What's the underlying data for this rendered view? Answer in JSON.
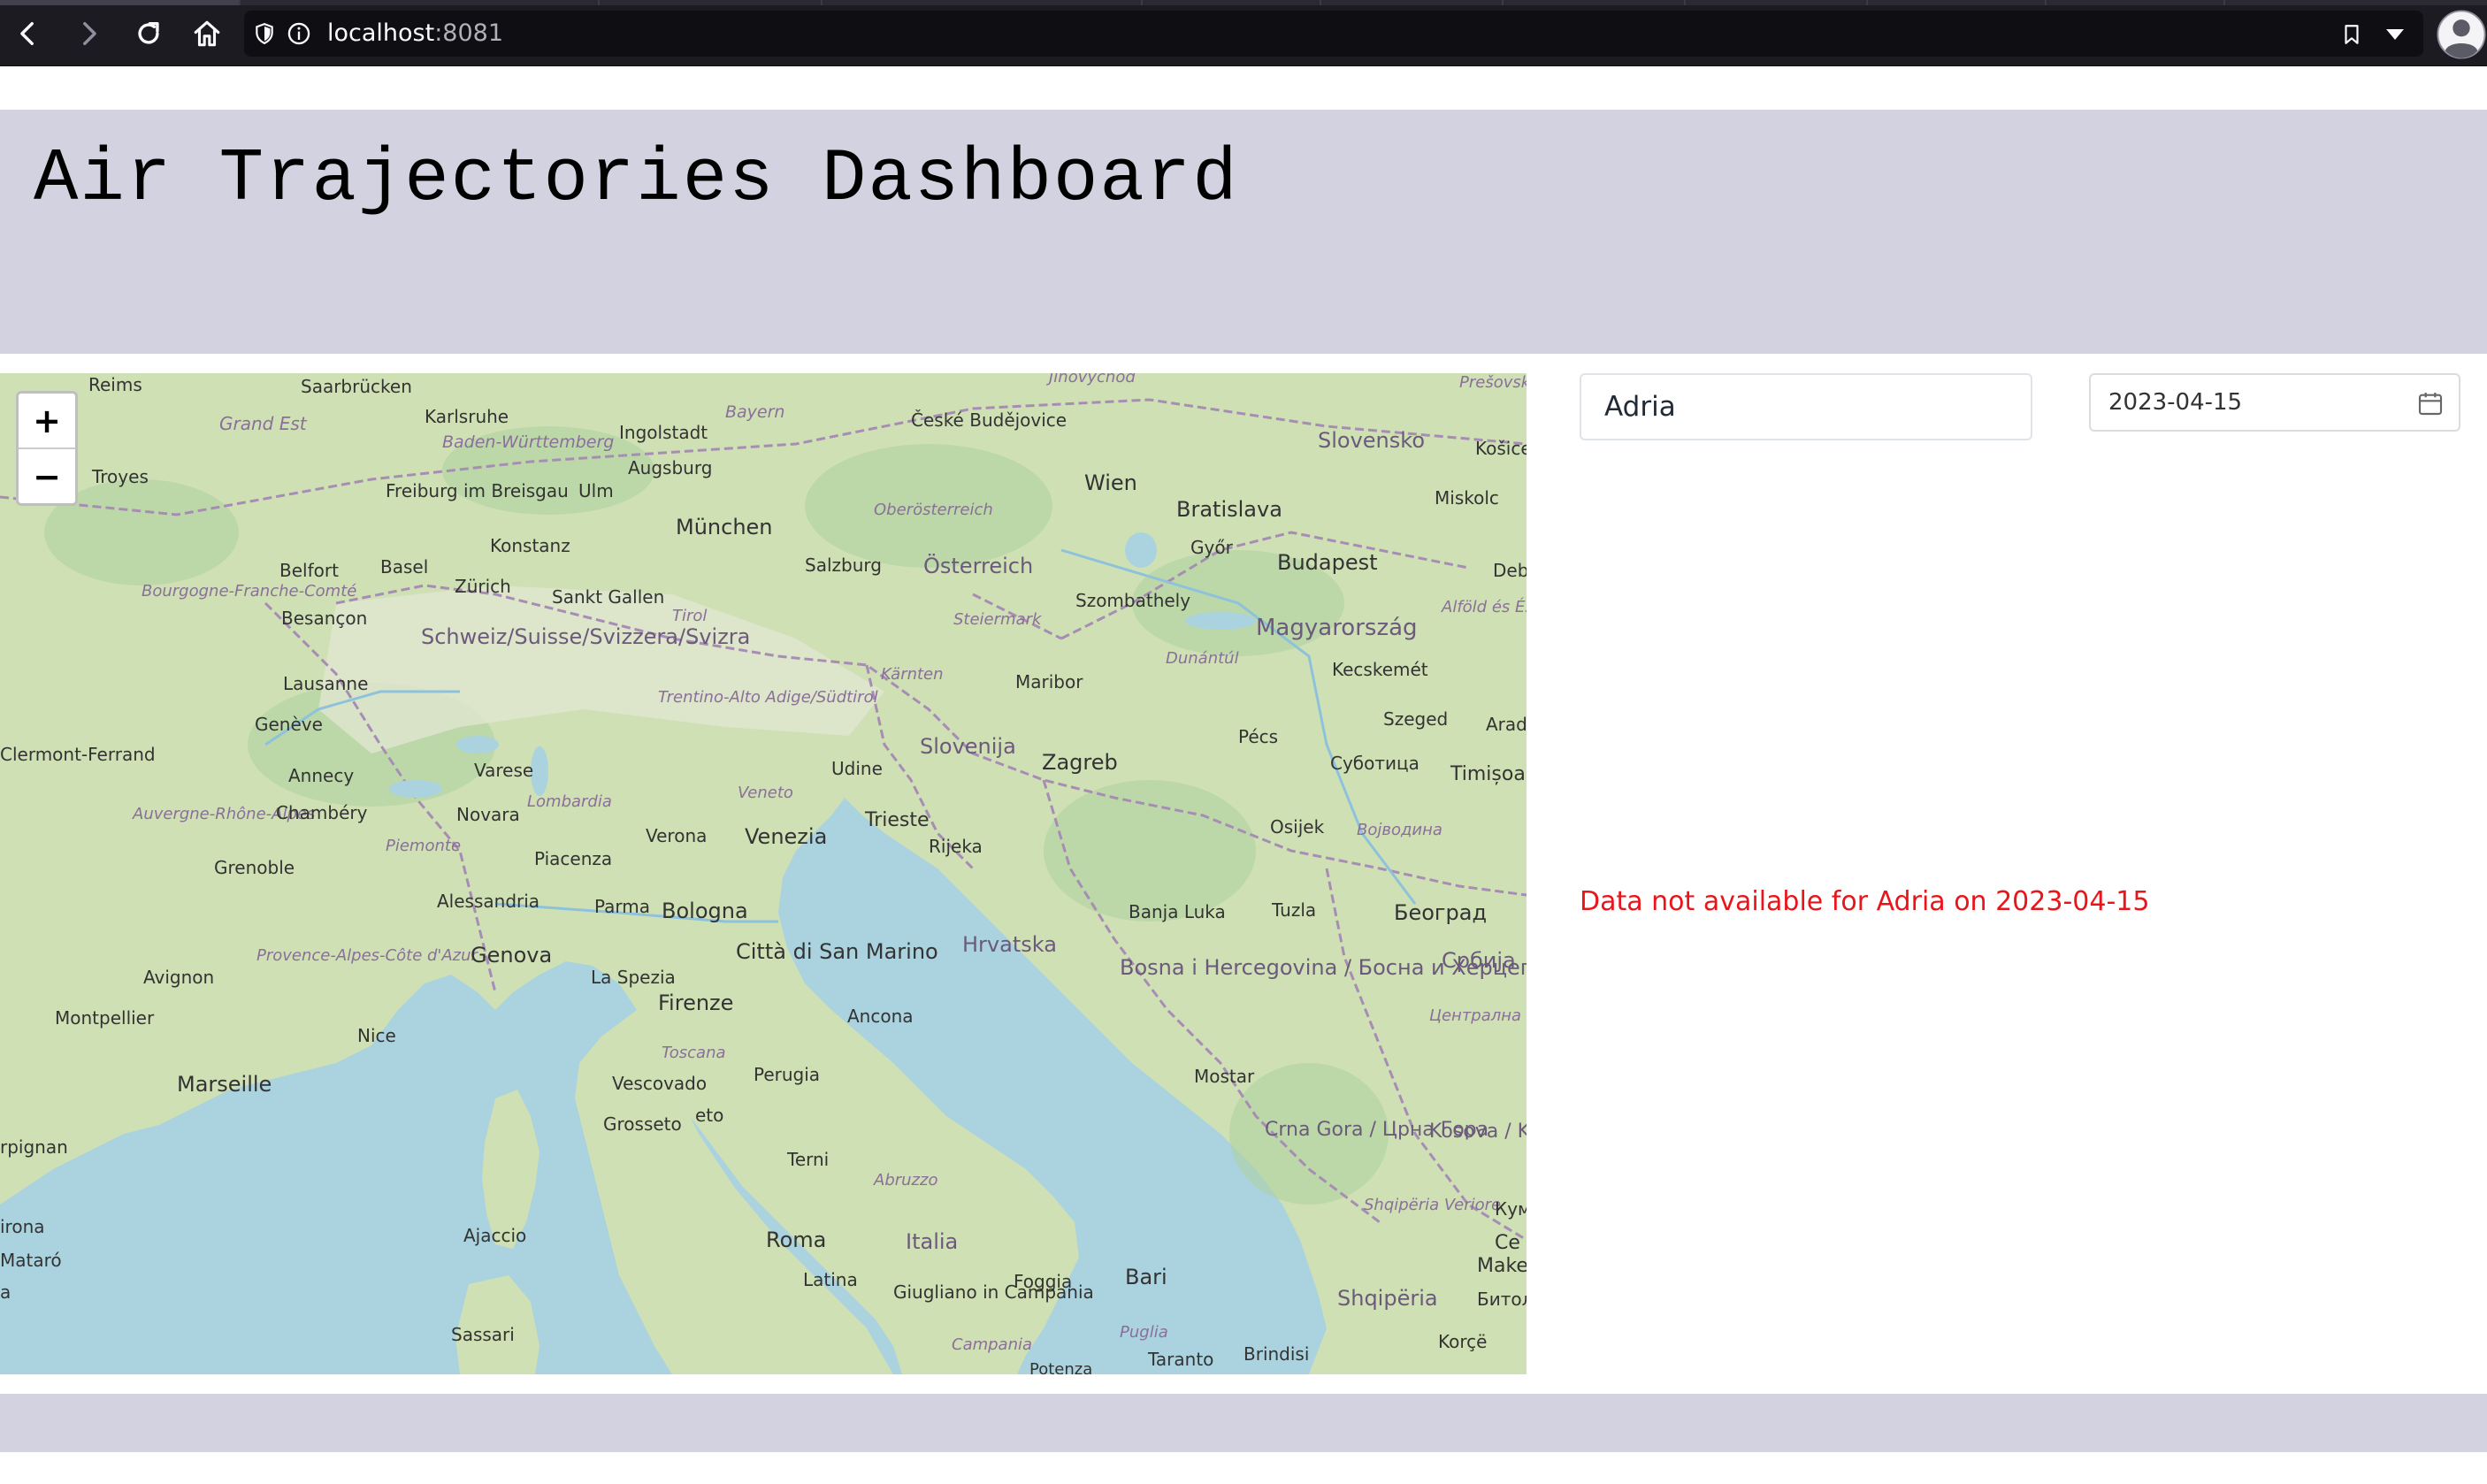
{
  "browser": {
    "url_host": "localhost",
    "url_port": ":8081",
    "icons": [
      "back-icon",
      "forward-icon",
      "reload-icon",
      "home-icon",
      "shield-icon",
      "info-icon",
      "bookmark-icon",
      "dropdown-icon",
      "profile-icon"
    ]
  },
  "page": {
    "title": "Air Trajectories Dashboard"
  },
  "map": {
    "zoom_in_label": "+",
    "zoom_out_label": "−",
    "labels": [
      "Reims",
      "Saarbrücken",
      "Karlsruhe",
      "Ingolstadt",
      "Bayern",
      "Jihovychod",
      "České Budějovice",
      "Prešovský kraj",
      "Grand Est",
      "Baden-Württemberg",
      "Augsburg",
      "Troyes",
      "Freiburg im Breisgau",
      "Ulm",
      "Slovensko",
      "Košice",
      "Wien",
      "Bratislava",
      "Miskolc",
      "München",
      "Oberösterreich",
      "Konstanz",
      "Győr",
      "Belfort",
      "Basel",
      "Zürich",
      "Salzburg",
      "Österreich",
      "Budapest",
      "Deb",
      "Sankt Gallen",
      "Szombathely",
      "Bourgogne-Franche-Comté",
      "Besançon",
      "Tirol",
      "Steiermark",
      "Alföld és Észak",
      "Schweiz/Suisse/Svizzera/Svizra",
      "Magyarország",
      "Dunántúl",
      "Lausanne",
      "Kärnten",
      "Maribor",
      "Kecskemét",
      "Trentino-Alto Adige/Südtirol",
      "Genève",
      "Slovenija",
      "Szeged",
      "Arad",
      "Pécs",
      "Clermont-Ferrand",
      "Varese",
      "Udine",
      "Zagreb",
      "Суботица",
      "Timișoa",
      "Annecy",
      "Veneto",
      "Lombardia",
      "Auvergne-Rhône-Alpes",
      "Chambéry",
      "Novara",
      "Trieste",
      "Osijek",
      "Војводина",
      "Verona",
      "Venezia",
      "Rijeka",
      "Piemonte",
      "Piacenza",
      "Grenoble",
      "Alessandria",
      "Parma",
      "Bologna",
      "Banja Luka",
      "Tuzla",
      "Београд",
      "Hrvatska",
      "Provence-Alpes-Côte d'Azur",
      "Genova",
      "Città di San Marino",
      "Србија",
      "Avignon",
      "La Spezia",
      "Bosna i Hercegovina / Босна и Херцеговина",
      "Firenze",
      "Ancona",
      "Montpellier",
      "Nice",
      "Централна Србија",
      "Toscana",
      "Marseille",
      "Mostar",
      "Perugia",
      "Vescovado",
      "Grosseto",
      "eto",
      "Crna Gora / Црна Гора",
      "Kosova / Kosovo",
      "rpignan",
      "Terni",
      "Abruzzo",
      "Shqipëria Veriore",
      "Кум",
      "Ajaccio",
      "Roma",
      "Italia",
      "Ce",
      "irona",
      "Bari",
      "Make",
      "Mataró",
      "Latina",
      "Foggia",
      "Shqipëria",
      "Битол",
      "a",
      "Sassari",
      "Giugliano in Campania",
      "Puglia",
      "Korçë",
      "Campania",
      "Taranto",
      "Brindisi",
      "Potenza"
    ]
  },
  "form": {
    "region_value": "Adria",
    "date_value": "2023-04-15"
  },
  "status": {
    "message": "Data not available for Adria on 2023-04-15",
    "color": "#e8151b"
  },
  "colors": {
    "header_bg": "#d2d2e0",
    "footer_bg": "#d2d2e0",
    "sea": "#aad3df",
    "land": "#c8dcae"
  }
}
